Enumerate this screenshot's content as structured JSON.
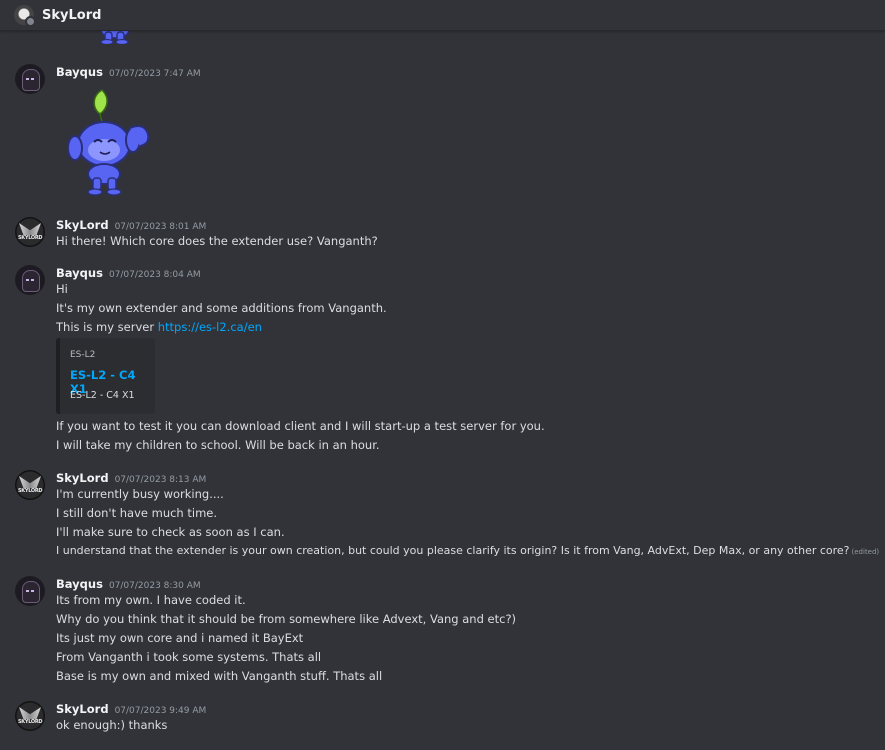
{
  "header": {
    "title": "SkyLord"
  },
  "messages": [
    {
      "author": "Bayqus",
      "timestamp": "07/07/2023 7:47 AM",
      "avatar": "bayqus-avatar",
      "sticker": "wumpus-sprout-wave-sticker"
    },
    {
      "author": "SkyLord",
      "timestamp": "07/07/2023 8:01 AM",
      "avatar": "skylord-avatar",
      "lines": [
        "Hi there! Which core does the extender use? Vanganth?"
      ]
    },
    {
      "author": "Bayqus",
      "timestamp": "07/07/2023 8:04 AM",
      "avatar": "bayqus-avatar",
      "lines": [
        "Hi",
        "It's my own extender and some additions from Vanganth.",
        "This is my server"
      ],
      "link": "https://es-l2.ca/en",
      "embed": {
        "provider": "ES-L2",
        "title": "ES-L2 - C4 X1",
        "description": "ES-L2 - C4 X1"
      },
      "after_lines": [
        "If you want to test it you can download client and I will start-up a test server for you.",
        "I will take my children to school. Will be back in an hour."
      ]
    },
    {
      "author": "SkyLord",
      "timestamp": "07/07/2023 8:13 AM",
      "avatar": "skylord-avatar",
      "lines": [
        "I'm currently busy working....",
        "I still don't have much time.",
        "I'll make sure to check as soon as I can.",
        "I understand that the extender is your own creation, but could you please clarify its origin? Is it from Vang, AdvExt, Dep Max, or any other core?"
      ],
      "edited_label": "(edited)"
    },
    {
      "author": "Bayqus",
      "timestamp": "07/07/2023 8:30 AM",
      "avatar": "bayqus-avatar",
      "lines": [
        "Its from my own. I have coded it.",
        "Why do you think that it should be from somewhere like Advext, Vang and etc?)",
        "Its just my own core and i named it BayExt",
        "From Vanganth i took some systems. Thats all",
        "Base is my own and mixed with Vanganth stuff. Thats all"
      ]
    },
    {
      "author": "SkyLord",
      "timestamp": "07/07/2023 9:49 AM",
      "avatar": "skylord-avatar",
      "lines": [
        "ok enough:) thanks"
      ]
    }
  ],
  "skylord_avatar_text": "SKYLORD",
  "colors": {
    "background": "#313338",
    "link": "#00a8fc",
    "text": "#dbdee1",
    "timestamp": "#949ba4",
    "wumpus": "#5865f2"
  }
}
